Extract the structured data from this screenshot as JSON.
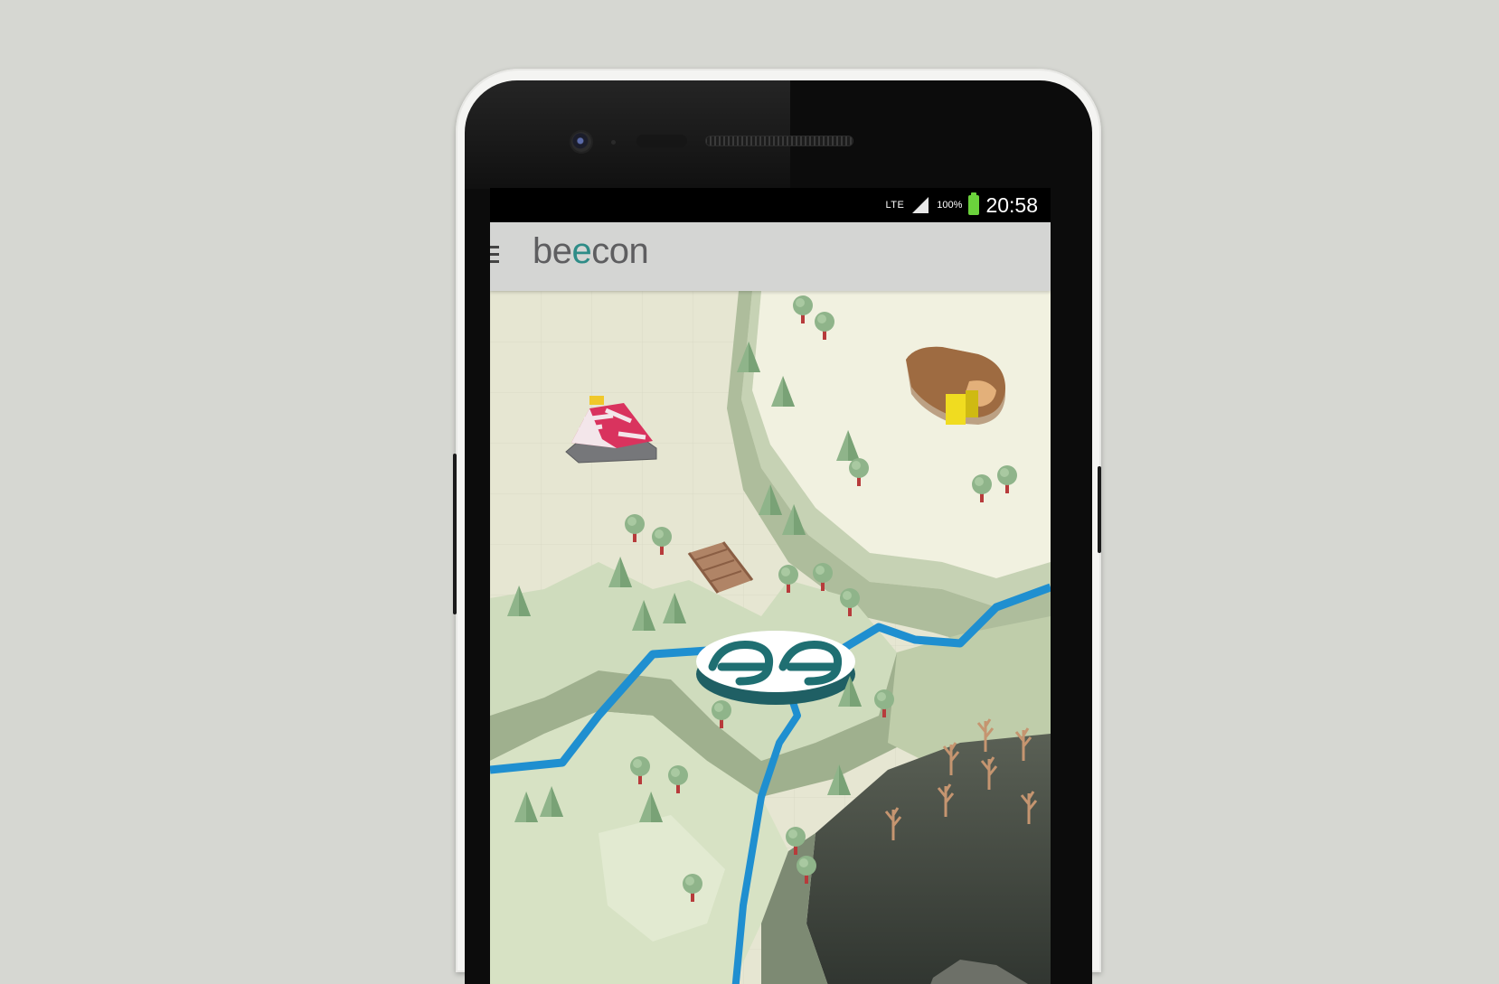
{
  "status_bar": {
    "network": "LTE",
    "battery_percent": "100%",
    "time": "20:58",
    "signal_icon": "signal-strength-icon",
    "battery_icon": "battery-full-icon",
    "battery_color": "#6bd23c"
  },
  "app_bar": {
    "title_start": "be",
    "title_accent": "e",
    "title_end": "con",
    "menu_icon": "hamburger-menu-icon",
    "accent_color": "#2e8c87"
  },
  "map": {
    "landmarks": [
      "circus-tent-icon",
      "stadium-icon",
      "beacon-logo-marker",
      "bridge-icon"
    ],
    "river_color": "#1f8fd0"
  }
}
